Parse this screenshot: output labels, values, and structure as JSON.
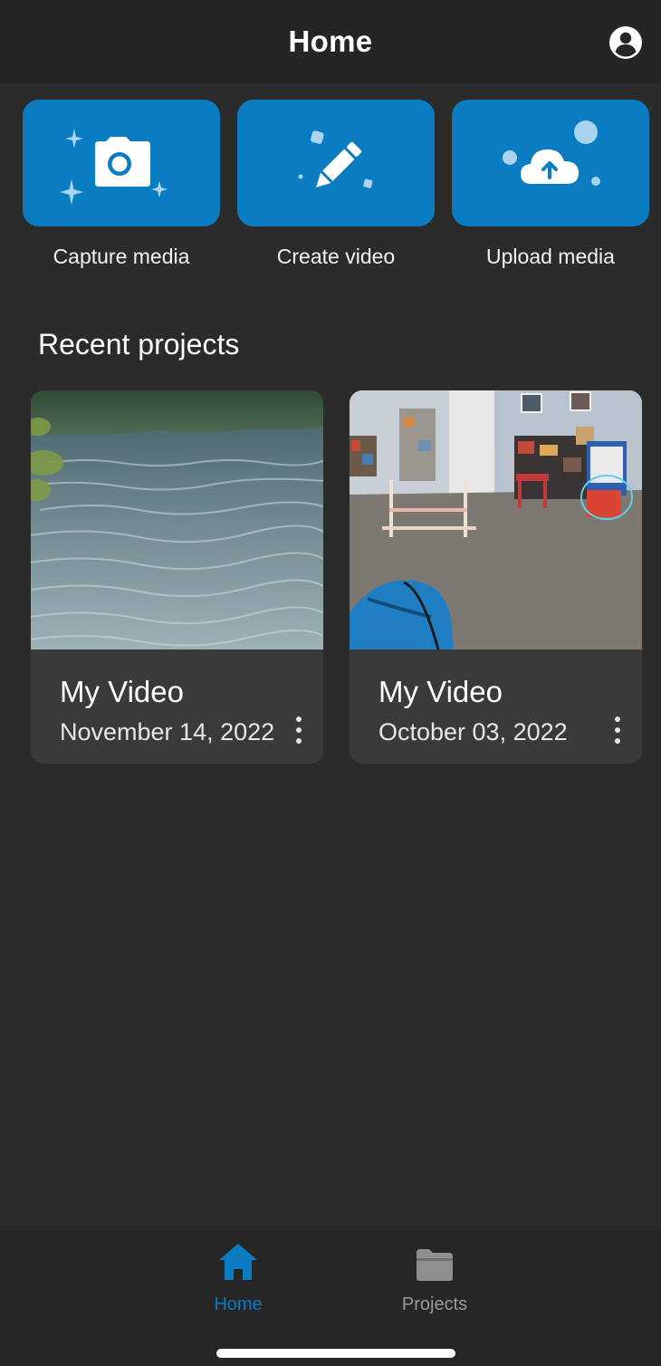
{
  "header": {
    "title": "Home",
    "account_icon": "account-circle-icon"
  },
  "actions": [
    {
      "label": "Capture media",
      "icon": "camera-sparkle-icon"
    },
    {
      "label": "Create video",
      "icon": "pencil-icon"
    },
    {
      "label": "Upload media",
      "icon": "cloud-upload-icon"
    }
  ],
  "recent": {
    "title": "Recent projects",
    "projects": [
      {
        "title": "My Video",
        "date": "November 14, 2022",
        "thumbnail": "lake-water-thumbnail"
      },
      {
        "title": "My Video",
        "date": "October 03, 2022",
        "thumbnail": "indoor-room-thumbnail"
      }
    ]
  },
  "tabs": [
    {
      "label": "Home",
      "icon": "home-icon",
      "active": true
    },
    {
      "label": "Projects",
      "icon": "folder-icon",
      "active": false
    }
  ],
  "colors": {
    "accent": "#0a7cc1",
    "background": "#2b2b2b",
    "header": "#252525",
    "card": "#3a3a3a",
    "inactive_tab": "#9a9a9a"
  }
}
